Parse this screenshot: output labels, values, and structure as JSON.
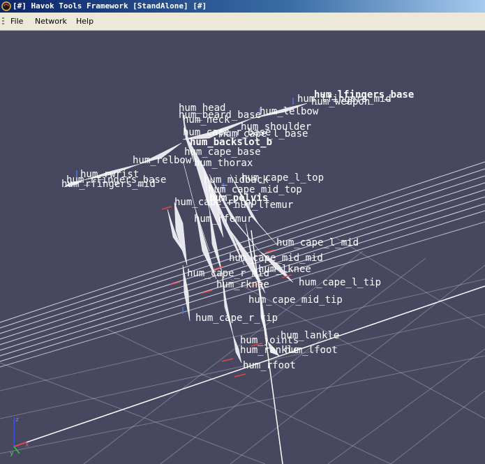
{
  "window": {
    "title": "[#] Havok Tools Framework [StandAlone] [#]"
  },
  "menu": {
    "file": "File",
    "network": "Network",
    "help": "Help"
  },
  "axis_gizmo": {
    "z": "z",
    "y": "y",
    "x": "x"
  },
  "bones": [
    {
      "name": "hum_head"
    },
    {
      "name": "hum_beard_base"
    },
    {
      "name": "hum_neck"
    },
    {
      "name": "hum_shoulder"
    },
    {
      "name": "hum_cape_l_base"
    },
    {
      "name": "hum_cape_r_base"
    },
    {
      "name": "hum_backslot_b"
    },
    {
      "name": "hum_cape_base"
    },
    {
      "name": "hum_thorax"
    },
    {
      "name": "hum_relbow"
    },
    {
      "name": "hum_lelbow"
    },
    {
      "name": "hum_rwrist"
    },
    {
      "name": "hum_weapon"
    },
    {
      "name": "hum_rfingers_mid"
    },
    {
      "name": "hum_rfingers_base"
    },
    {
      "name": "hum_lfingers_base"
    },
    {
      "name": "hum_lfingers_mid"
    },
    {
      "name": "hum_midback"
    },
    {
      "name": "hum_cape_l_top"
    },
    {
      "name": "hum_cape_mid_top"
    },
    {
      "name": "hum_pelvis"
    },
    {
      "name": "hum_cape_r_top"
    },
    {
      "name": "hum_lfemur"
    },
    {
      "name": "hum_rfemur"
    },
    {
      "name": "hum_cape_l_mid"
    },
    {
      "name": "hum_cape_mid_mid"
    },
    {
      "name": "hum_lknee"
    },
    {
      "name": "hum_cape_r_mid"
    },
    {
      "name": "hum_cape_l_tip"
    },
    {
      "name": "hum_rknee"
    },
    {
      "name": "hum_cape_mid_tip"
    },
    {
      "name": "hum_cape_r_tip"
    },
    {
      "name": "hum_lankle"
    },
    {
      "name": "hum_joints"
    },
    {
      "name": "hum_rankle"
    },
    {
      "name": "hum_lfoot"
    },
    {
      "name": "hum_rfoot"
    }
  ]
}
